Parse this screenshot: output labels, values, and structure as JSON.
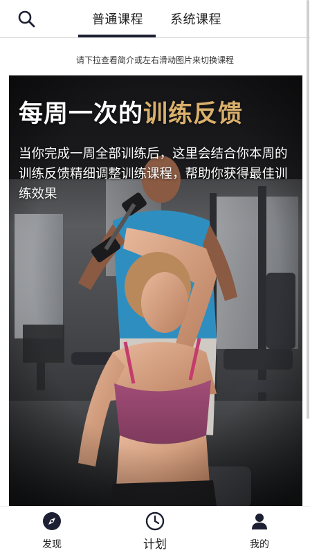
{
  "header": {
    "search_icon": "search-icon",
    "tabs": [
      {
        "label": "普通课程",
        "active": true
      },
      {
        "label": "系统课程",
        "active": false
      }
    ],
    "accent_color": "#1d2033"
  },
  "hint": "请下拉查看简介或左右滑动图片来切换课程",
  "hero": {
    "title_white": "每周一次的",
    "title_gold": "训练反馈",
    "title_gold_color": "#d9b06c",
    "description": "当你完成一周全部训练后，这里会结合你本周的训练反馈精细调整训练课程，帮助你获得最佳训练效果"
  },
  "bottom_nav": {
    "items": [
      {
        "label": "发现",
        "icon": "compass-icon"
      },
      {
        "label": "计划",
        "icon": "clock-icon"
      },
      {
        "label": "我的",
        "icon": "user-icon"
      }
    ]
  }
}
